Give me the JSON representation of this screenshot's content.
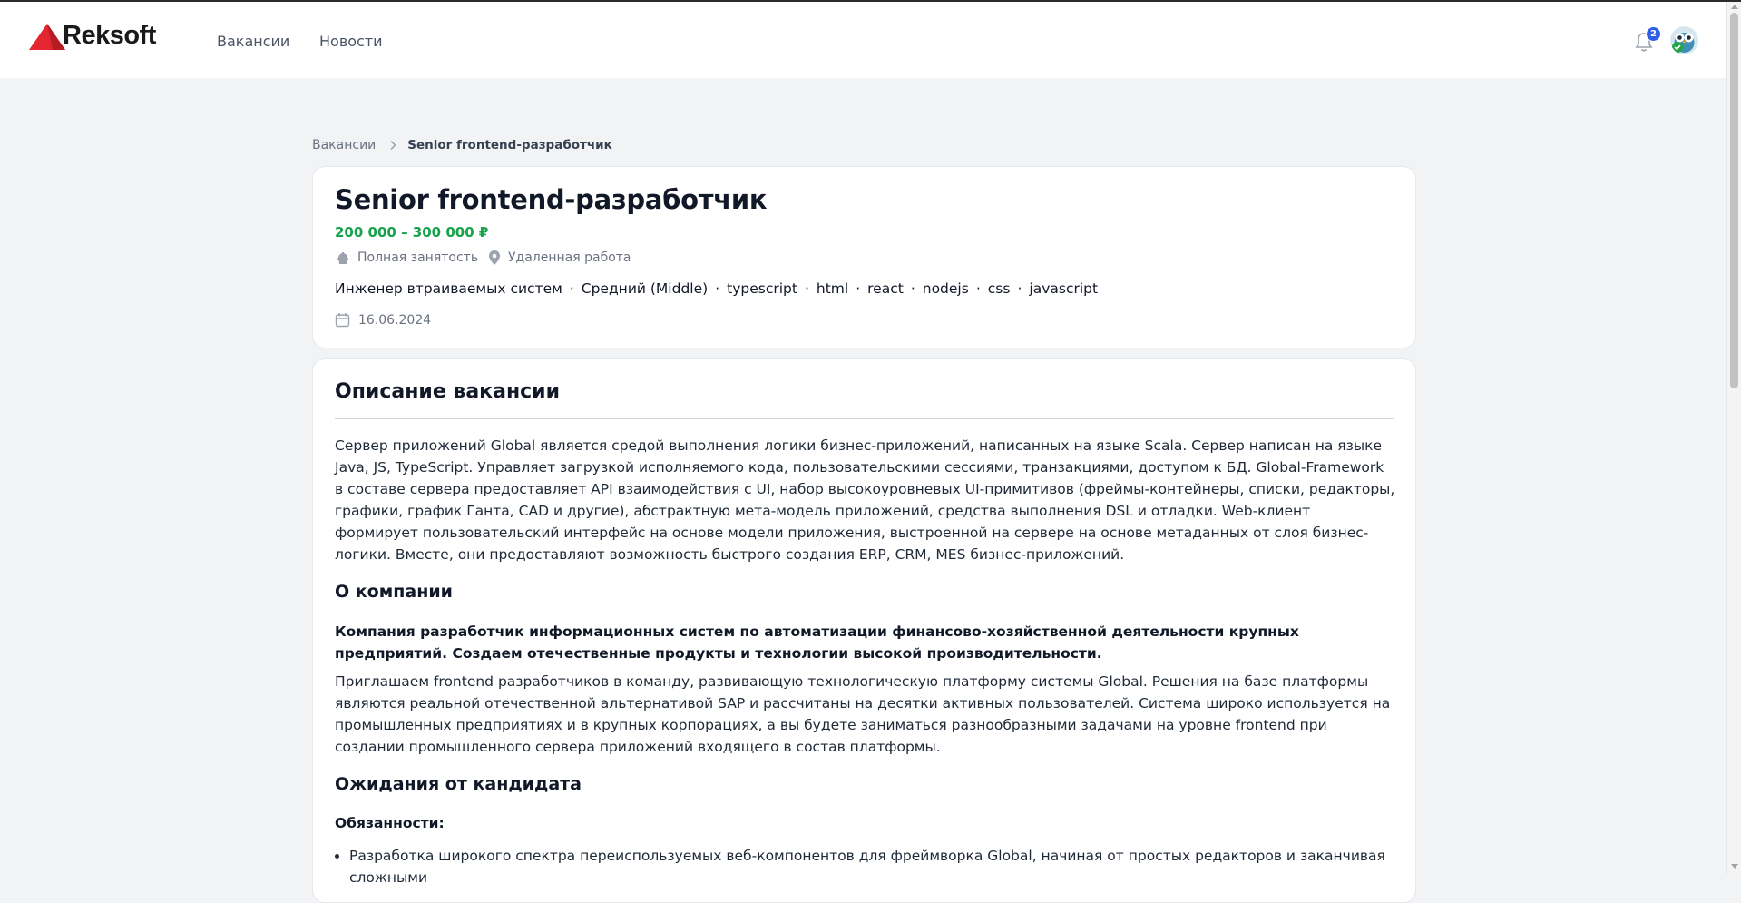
{
  "header": {
    "logo_text": "Reksoft",
    "nav": [
      "Вакансии",
      "Новости"
    ],
    "notification_count": "2"
  },
  "breadcrumb": {
    "parent": "Вакансии",
    "current": "Senior frontend-разработчик"
  },
  "job": {
    "title": "Senior frontend-разработчик",
    "salary": "200 000 – 300 000 ₽",
    "employment": "Полная занятость",
    "location": "Удаленная работа",
    "tags": [
      "Инженер втраиваемых систем",
      "Средний (Middle)",
      "typescript",
      "html",
      "react",
      "nodejs",
      "css",
      "javascript"
    ],
    "date": "16.06.2024"
  },
  "description": {
    "title": "Описание вакансии",
    "text": "Сервер приложений Global является средой выполнения логики бизнес-приложений, написанных на языке Scala. Сервер написан на языке Java, JS, TypeScript. Управляет загрузкой исполняемого кода, пользовательскими сессиями, транзакциями, доступом к БД. Global-Framework в составе сервера предоставляет API взаимодействия с UI, набор высокоуровневых UI-примитивов (фреймы-контейнеры, списки, редакторы, графики, график Ганта, CAD и другие), абстрактную мета-модель приложений, средства выполнения DSL и отладки. Web-клиент формирует пользовательский интерфейс на основе модели приложения, выстроенной на сервере на основе метаданных от слоя бизнес-логики. Вместе, они предоставляют возможность быстрого создания ERP, CRM, MES бизнес-приложений.",
    "company_title": "О компании",
    "company_bold": "Компания разработчик информационных систем по автоматизации финансово-хозяйственной деятельности крупных предприятий. Создаем отечественные продукты и технологии высокой производительности.",
    "company_text": "Приглашаем frontend разработчиков в команду, развивающую технологическую платформу системы Global. Решения на базе платформы являются реальной отечественной альтернативой SAP и рассчитаны на десятки активных пользователей. Система широко используется на промышленных предприятиях и в крупных корпорациях, а вы будете заниматься разнообразными задачами на уровне frontend при создании промышленного сервера приложений входящего в состав платформы.",
    "expectations_title": "Ожидания от кандидата",
    "duties_title": "Обязанности:",
    "duties": [
      "Разработка широкого спектра переиспользуемых веб-компонентов для фреймворка Global, начиная от простых редакторов и заканчивая сложными"
    ]
  },
  "colors": {
    "accent_green": "#16a34a",
    "brand_red": "#e3262f",
    "badge_blue": "#2f5fe8"
  }
}
